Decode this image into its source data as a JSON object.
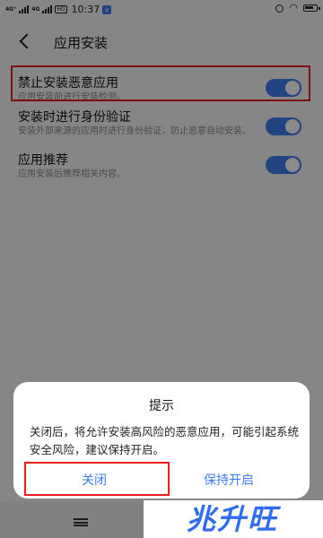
{
  "status_bar": {
    "signal_1": "4G⁺",
    "signal_2": "4G",
    "hd_badge": "HD",
    "time": "10:37",
    "notification_badge": "v"
  },
  "header": {
    "title": "应用安装"
  },
  "settings": [
    {
      "title": "禁止安装恶意应用",
      "desc": "应用安装前进行安装检测。",
      "enabled": true
    },
    {
      "title": "安装时进行身份验证",
      "desc": "安装外部来源的应用时进行身份验证，防止恶意自动安装。",
      "enabled": true
    },
    {
      "title": "应用推荐",
      "desc": "应用安装后推荐相关内容。",
      "enabled": true
    }
  ],
  "dialog": {
    "title": "提示",
    "message": "关闭后，将允许安装高风险的恶意应用，可能引起系统安全风险，建议保持开启。",
    "close_label": "关闭",
    "keep_label": "保持开启"
  },
  "watermark": {
    "text": "兆升旺"
  },
  "colors": {
    "accent": "#3f7ef3",
    "highlight": "#ee1c1c"
  }
}
